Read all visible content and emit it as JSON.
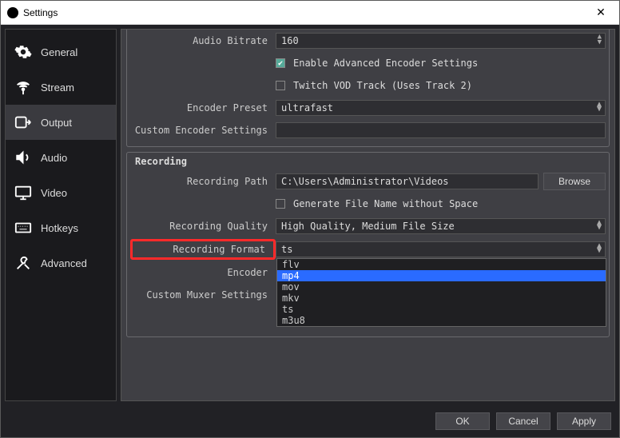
{
  "window": {
    "title": "Settings",
    "close": "✕"
  },
  "sidebar": [
    {
      "name": "general",
      "label": "General"
    },
    {
      "name": "stream",
      "label": "Stream"
    },
    {
      "name": "output",
      "label": "Output"
    },
    {
      "name": "audio",
      "label": "Audio"
    },
    {
      "name": "video",
      "label": "Video"
    },
    {
      "name": "hotkeys",
      "label": "Hotkeys"
    },
    {
      "name": "advanced",
      "label": "Advanced"
    }
  ],
  "top": {
    "audio_bitrate_label": "Audio Bitrate",
    "audio_bitrate_value": "160",
    "enable_adv_label": "Enable Advanced Encoder Settings",
    "twitch_vod_label": "Twitch VOD Track (Uses Track 2)",
    "encoder_preset_label": "Encoder Preset",
    "encoder_preset_value": "ultrafast",
    "custom_enc_label": "Custom Encoder Settings"
  },
  "rec": {
    "title": "Recording",
    "path_label": "Recording Path",
    "path_value": "C:\\Users\\Administrator\\Videos",
    "browse": "Browse",
    "gen_filename_label": "Generate File Name without Space",
    "quality_label": "Recording Quality",
    "quality_value": "High Quality, Medium File Size",
    "format_label": "Recording Format",
    "format_value": "ts",
    "encoder_label": "Encoder",
    "muxer_label": "Custom Muxer Settings",
    "options": [
      "flv",
      "mp4",
      "mov",
      "mkv",
      "ts",
      "m3u8"
    ],
    "selected_option": "mp4"
  },
  "footer": {
    "ok": "OK",
    "cancel": "Cancel",
    "apply": "Apply"
  }
}
